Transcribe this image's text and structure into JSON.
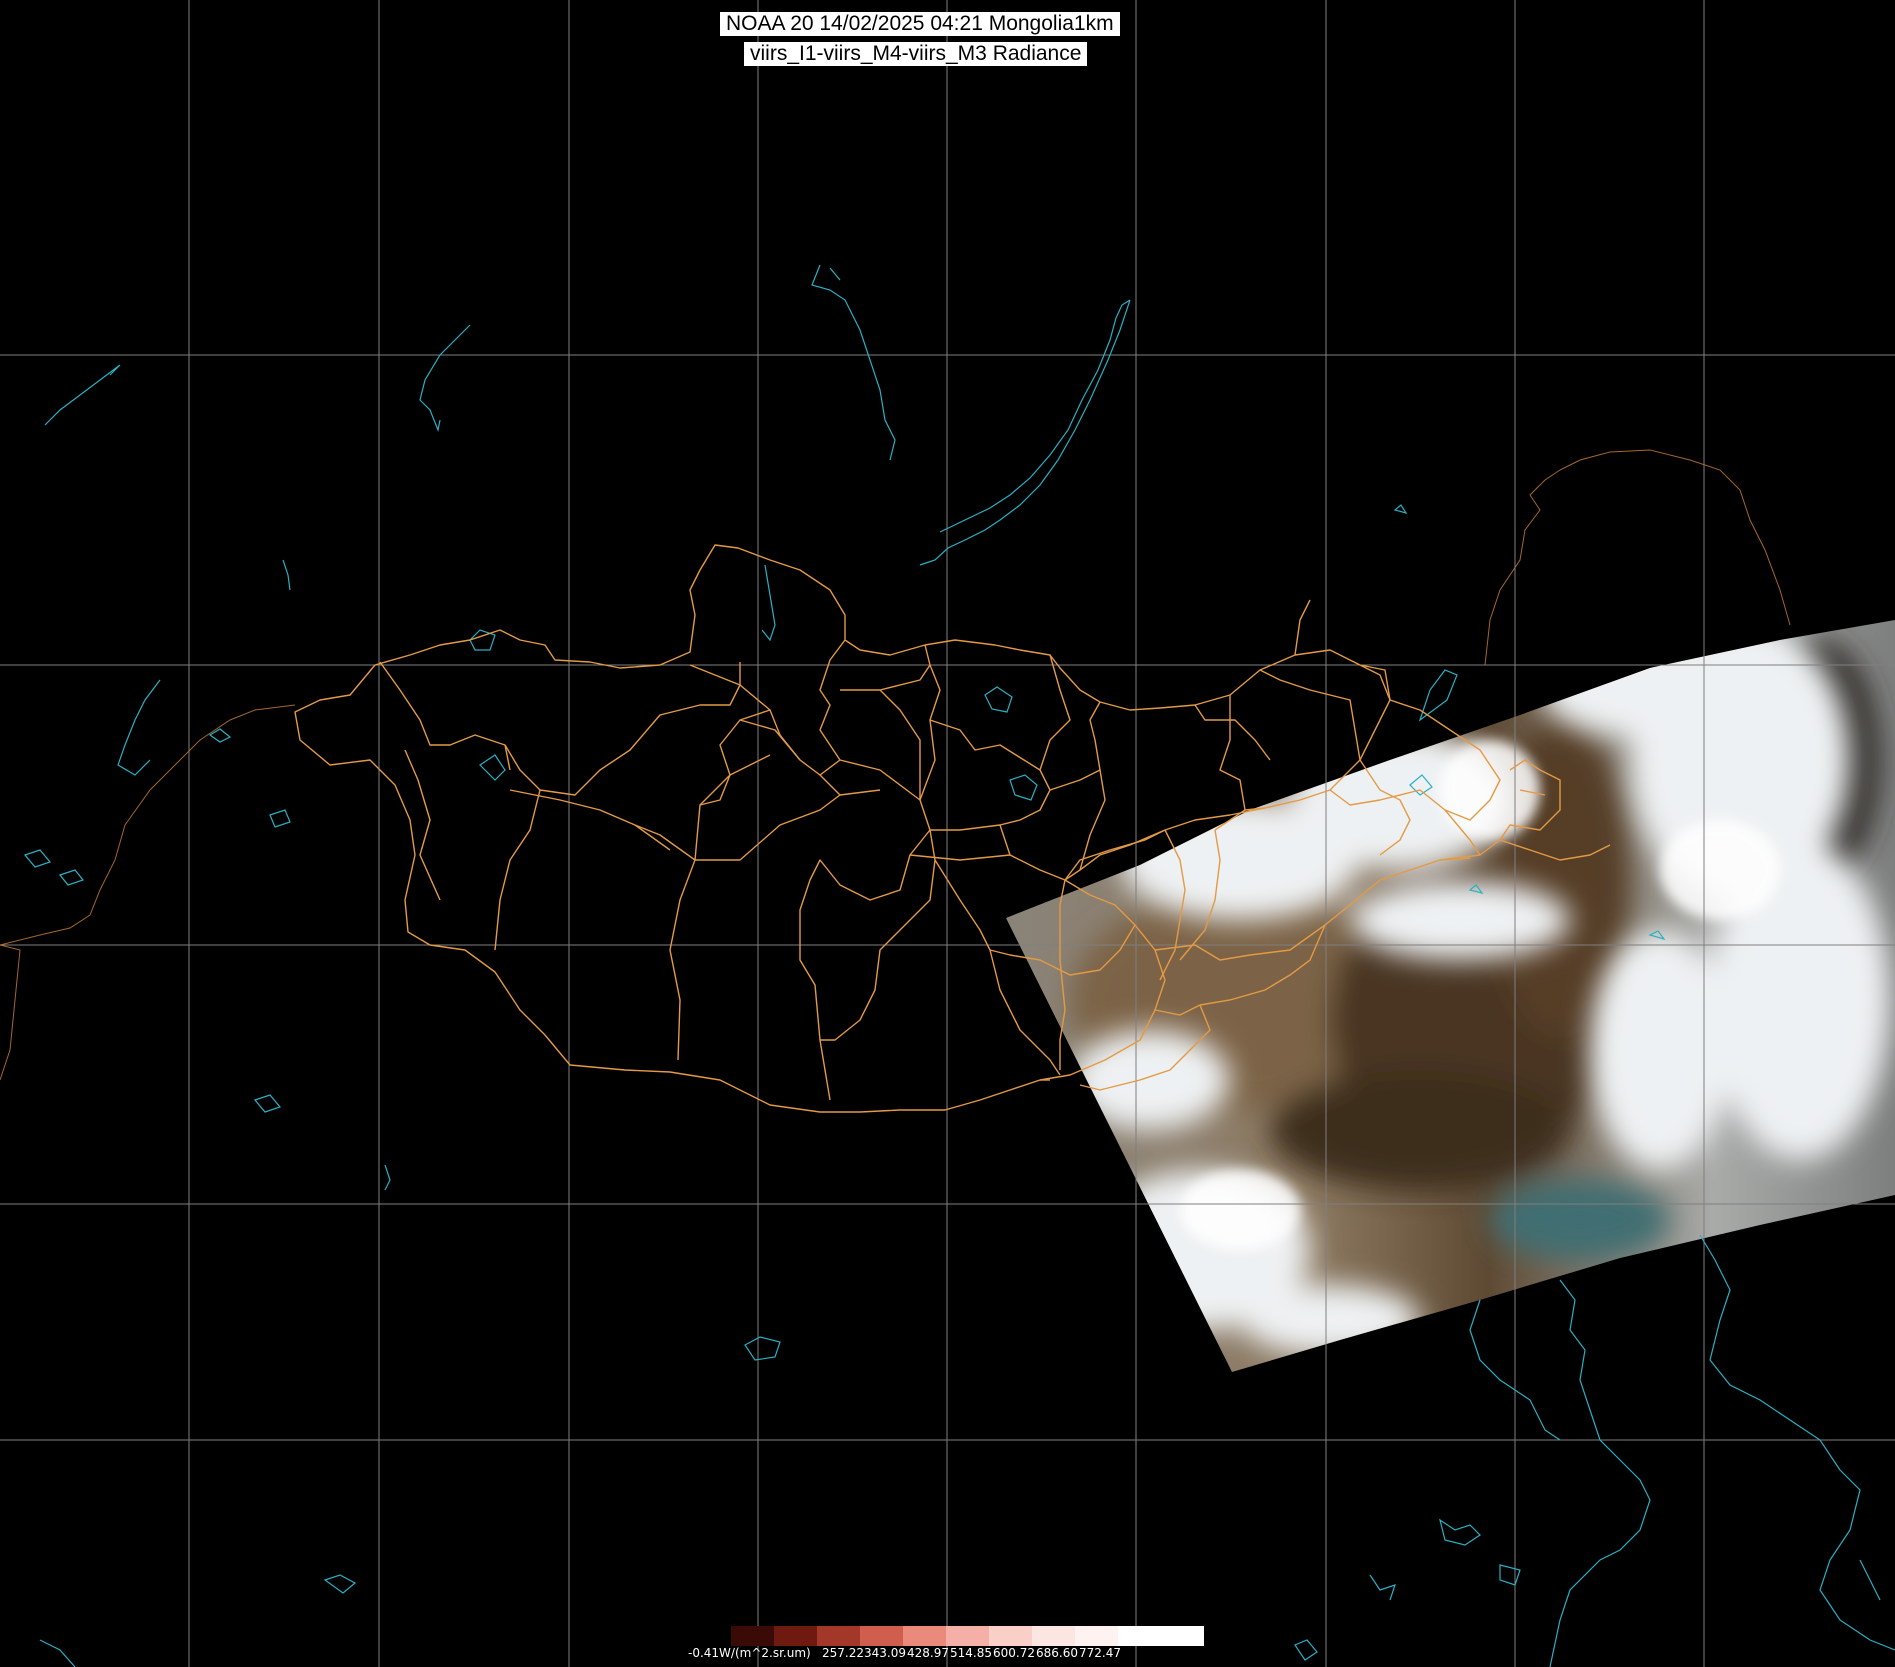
{
  "title": {
    "line1": "NOAA 20 14/02/2025 04:21 Mongolia1km",
    "line2": "viirs_I1-viirs_M4-viirs_M3 Radiance"
  },
  "colorbar": {
    "labels": [
      "-0.41W/(m^2.sr.um)",
      "257.22",
      "343.09",
      "428.97",
      "514.85",
      "600.72",
      "686.60",
      "772.47"
    ],
    "colors": [
      "#000000",
      "#3a0a06",
      "#6e1a10",
      "#a3382a",
      "#cf5e4e",
      "#ea8a7c",
      "#f4b0a6",
      "#f9cfc8",
      "#fce6e2",
      "#fef3f1",
      "#ffffff",
      "#ffffff"
    ]
  },
  "colors": {
    "background": "#000000",
    "graticule": "#7f7f7f",
    "coastline": "#2ab0c4",
    "admin_boundary": "#e39a45",
    "snow": "#eef1f3",
    "bare_ground": "#6a5134"
  }
}
